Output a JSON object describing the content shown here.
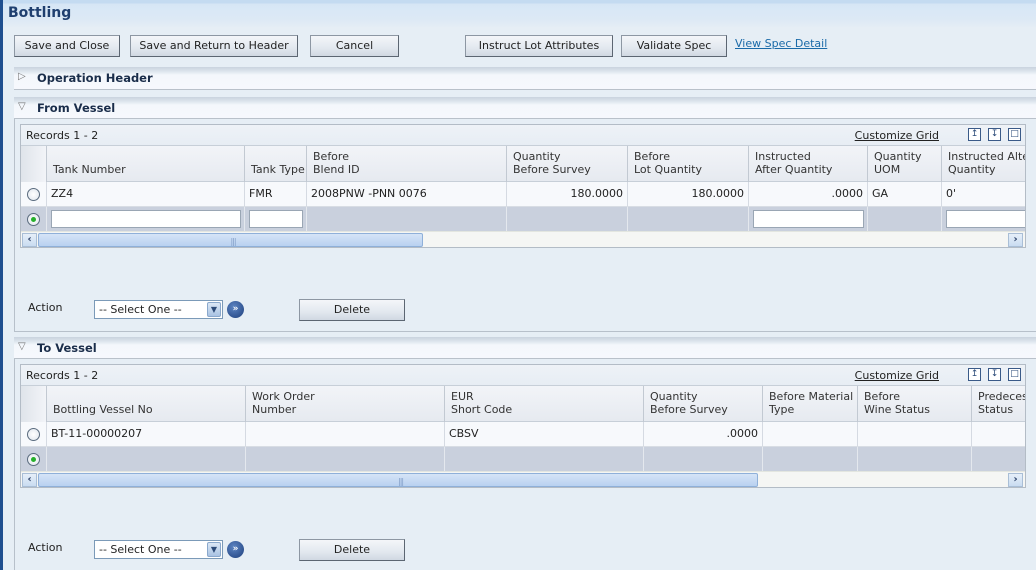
{
  "window": {
    "title": "Bottling"
  },
  "toolbar": {
    "save_close": "Save and Close",
    "save_return": "Save and Return to Header",
    "cancel": "Cancel",
    "instruct_lot": "Instruct Lot Attributes",
    "validate_spec": "Validate Spec",
    "view_spec_detail": "View Spec Detail"
  },
  "sections": {
    "operation_header": {
      "label": "Operation Header",
      "expanded": false
    },
    "from_vessel": {
      "label": "From Vessel",
      "expanded": true,
      "grid": {
        "records": "Records 1 - 2",
        "customize": "Customize Grid",
        "icons": [
          "export-icon",
          "import-icon",
          "maximize-icon"
        ],
        "columns": [
          {
            "l1": "",
            "l2": "Tank Number"
          },
          {
            "l1": "",
            "l2": "Tank Type"
          },
          {
            "l1": "Before",
            "l2": "Blend ID"
          },
          {
            "l1": "Quantity",
            "l2": "Before Survey"
          },
          {
            "l1": "Before",
            "l2": "Lot Quantity"
          },
          {
            "l1": "Instructed",
            "l2": "After Quantity"
          },
          {
            "l1": "Quantity",
            "l2": "UOM"
          },
          {
            "l1": "Instructed Alter",
            "l2": "Quantity"
          }
        ],
        "rows": [
          {
            "selected": false,
            "cells": [
              "ZZ4",
              "FMR",
              "2008PNW   -PNN   0076",
              "180.0000",
              "180.0000",
              ".0000",
              "GA",
              "0'"
            ]
          },
          {
            "selected": true,
            "cells": [
              "",
              "",
              "",
              "",
              "",
              "",
              "",
              ""
            ]
          }
        ]
      },
      "action": {
        "label": "Action",
        "select_value": "-- Select One --",
        "delete": "Delete"
      }
    },
    "to_vessel": {
      "label": "To Vessel",
      "expanded": true,
      "grid": {
        "records": "Records 1 - 2",
        "customize": "Customize Grid",
        "icons": [
          "export-icon",
          "import-icon",
          "maximize-icon"
        ],
        "columns": [
          {
            "l1": "",
            "l2": "Bottling Vessel No"
          },
          {
            "l1": "Work Order",
            "l2": "Number"
          },
          {
            "l1": "EUR",
            "l2": "Short Code"
          },
          {
            "l1": "Quantity",
            "l2": "Before Survey"
          },
          {
            "l1": "Before Material",
            "l2": "Type"
          },
          {
            "l1": "Before",
            "l2": "Wine Status"
          },
          {
            "l1": "Predecess",
            "l2": "Status"
          }
        ],
        "rows": [
          {
            "selected": false,
            "cells": [
              "BT-11-00000207",
              "",
              "CBSV",
              ".0000",
              "",
              "",
              ""
            ]
          },
          {
            "selected": true,
            "cells": [
              "",
              "",
              "",
              "",
              "",
              "",
              ""
            ]
          }
        ]
      },
      "action": {
        "label": "Action",
        "select_value": "-- Select One --",
        "delete": "Delete"
      }
    }
  }
}
